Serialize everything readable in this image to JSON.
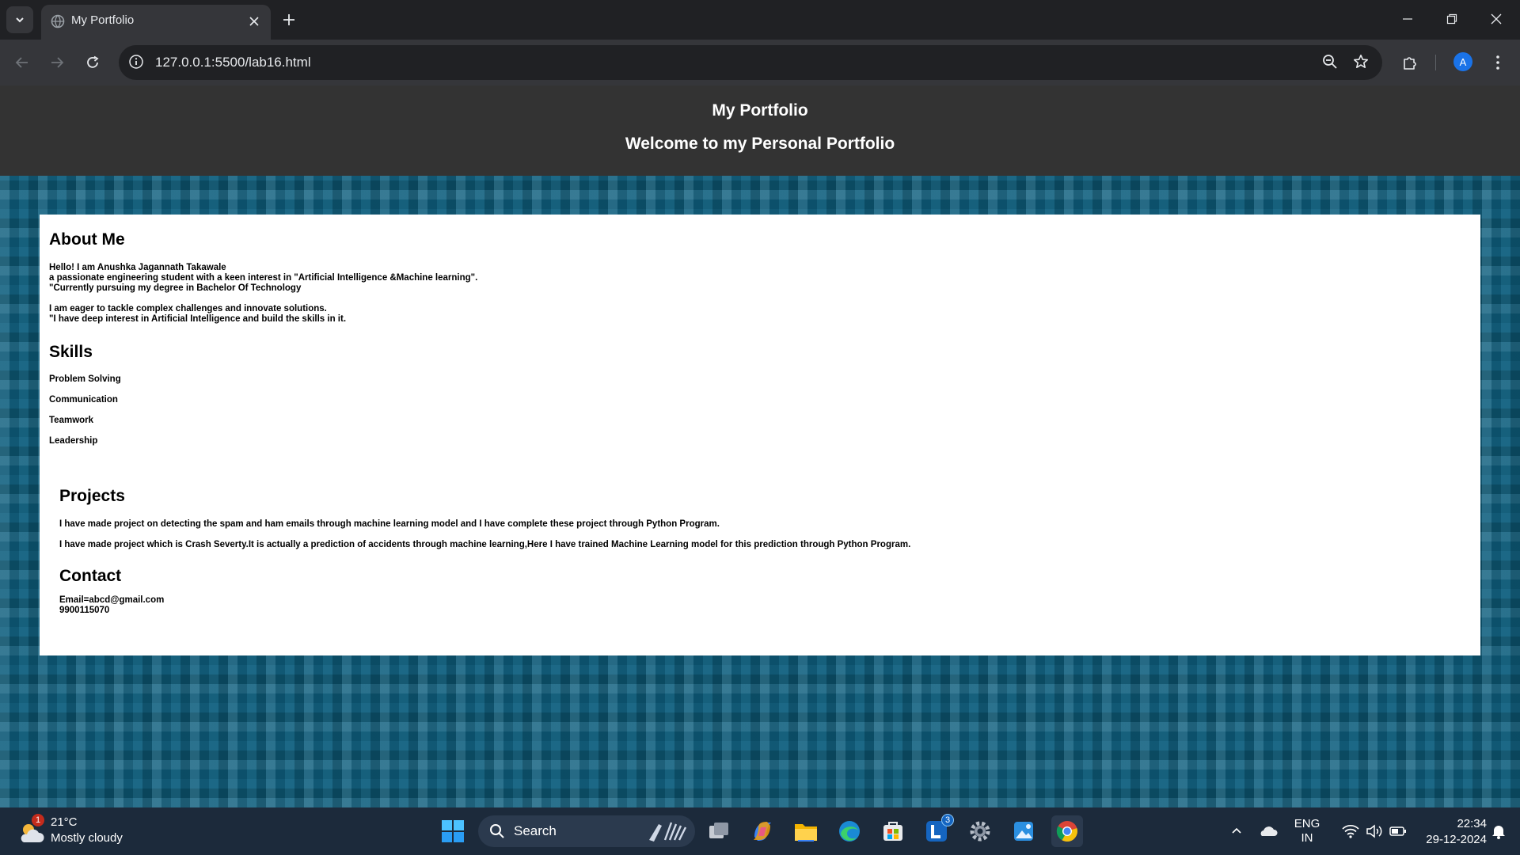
{
  "browser": {
    "tab_title": "My Portfolio",
    "url": "127.0.0.1:5500/lab16.html",
    "profile_initial": "A"
  },
  "header": {
    "title": "My Portfolio",
    "subtitle": "Welcome to my Personal Portfolio"
  },
  "about": {
    "heading": "About Me",
    "lines": [
      "Hello! I am Anushka Jagannath Takawale",
      "a passionate engineering student with a keen interest in \"Artificial Intelligence &Machine learning\".",
      "\"Currently pursuing my degree in Bachelor Of Technology",
      "I am eager to tackle complex challenges and innovate solutions.",
      "\"I have deep interest in Artificial Intelligence and build the skills in it."
    ]
  },
  "skills": {
    "heading": "Skills",
    "items": [
      "Problem Solving",
      "Communication",
      "Teamwork",
      "Leadership"
    ]
  },
  "projects": {
    "heading": "Projects",
    "items": [
      "I have made project on detecting the spam and ham emails through machine learning model and I have complete these project through Python Program.",
      "I have made project which is Crash Severty.It is actually a prediction of accidents through machine learning,Here I have trained Machine Learning model for this prediction through Python Program."
    ]
  },
  "contact": {
    "heading": "Contact",
    "email": "Email=abcd@gmail.com",
    "phone": "9900115070"
  },
  "taskbar": {
    "weather_temp": "21°C",
    "weather_desc": "Mostly cloudy",
    "weather_badge": "1",
    "search_label": "Search",
    "app_badge": "3",
    "lang_top": "ENG",
    "lang_bottom": "IN",
    "time": "22:34",
    "date": "29-12-2024"
  },
  "colors": {
    "header_bg": "#333333",
    "page_pattern": "#0e5f7e",
    "card_bg": "#ffffff",
    "taskbar_bg": "#1c2a3b",
    "accent": "#1a73e8"
  }
}
